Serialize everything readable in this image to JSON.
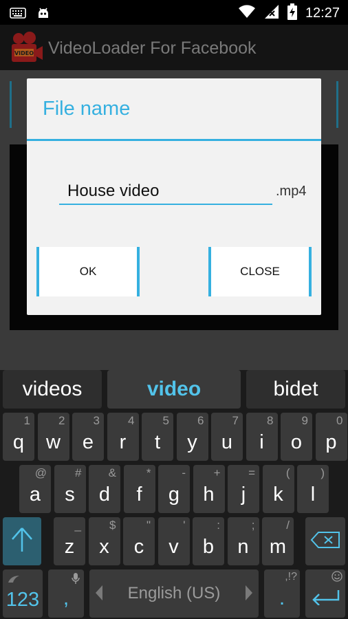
{
  "status_bar": {
    "time": "12:27"
  },
  "app": {
    "title": "VideoLoader For Facebook",
    "icon_badge": "VIDEO"
  },
  "dialog": {
    "title": "File name",
    "filename": "House video",
    "extension": ".mp4",
    "ok_label": "OK",
    "close_label": "CLOSE"
  },
  "keyboard": {
    "suggestions": [
      "videos",
      "video",
      "bidet"
    ],
    "row1": [
      {
        "k": "q",
        "h": "1"
      },
      {
        "k": "w",
        "h": "2"
      },
      {
        "k": "e",
        "h": "3"
      },
      {
        "k": "r",
        "h": "4"
      },
      {
        "k": "t",
        "h": "5"
      },
      {
        "k": "y",
        "h": "6"
      },
      {
        "k": "u",
        "h": "7"
      },
      {
        "k": "i",
        "h": "8"
      },
      {
        "k": "o",
        "h": "9"
      },
      {
        "k": "p",
        "h": "0"
      }
    ],
    "row2": [
      {
        "k": "a",
        "h": "@"
      },
      {
        "k": "s",
        "h": "#"
      },
      {
        "k": "d",
        "h": "&"
      },
      {
        "k": "f",
        "h": "*"
      },
      {
        "k": "g",
        "h": "-"
      },
      {
        "k": "h",
        "h": "+"
      },
      {
        "k": "j",
        "h": "="
      },
      {
        "k": "k",
        "h": "("
      },
      {
        "k": "l",
        "h": ")"
      }
    ],
    "row3": [
      {
        "k": "z",
        "h": "_"
      },
      {
        "k": "x",
        "h": "$"
      },
      {
        "k": "c",
        "h": "\""
      },
      {
        "k": "v",
        "h": "'"
      },
      {
        "k": "b",
        "h": ":"
      },
      {
        "k": "n",
        "h": ";"
      },
      {
        "k": "m",
        "h": "/"
      }
    ],
    "numbers_label": "123",
    "comma": ",",
    "period": ".",
    "period_hint": ",!?",
    "space_label": "English (US)"
  },
  "colors": {
    "accent": "#35b0e0",
    "suggestion_highlight": "#52c3ea"
  }
}
